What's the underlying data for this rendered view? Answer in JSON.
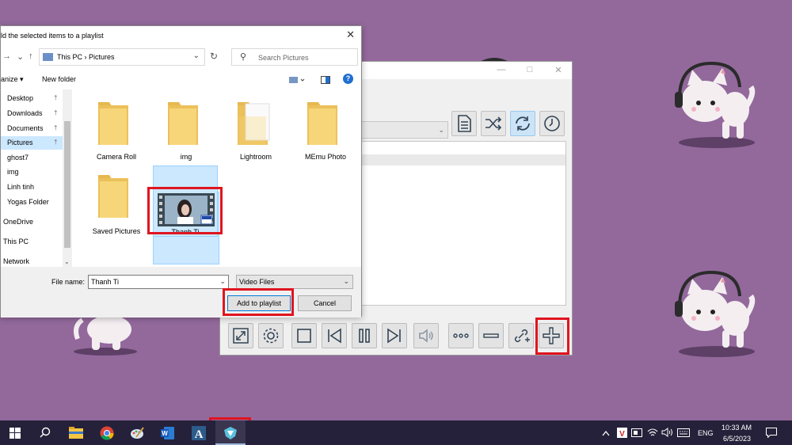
{
  "dialog": {
    "title": "ld the selected items to a playlist",
    "address": {
      "crumbs": "This PC  ›  Pictures"
    },
    "search_placeholder": "Search Pictures",
    "toolbar": {
      "organize": "anize ▾",
      "new_folder": "New folder"
    },
    "nav_items": [
      {
        "label": "Desktop",
        "pinned": true
      },
      {
        "label": "Downloads",
        "pinned": true
      },
      {
        "label": "Documents",
        "pinned": true
      },
      {
        "label": "Pictures",
        "pinned": true,
        "selected": true
      },
      {
        "label": "ghost7"
      },
      {
        "label": "img"
      },
      {
        "label": "Linh tinh"
      },
      {
        "label": "Yogas Folder"
      },
      {
        "label": "OneDrive"
      },
      {
        "label": "This PC"
      },
      {
        "label": "Network"
      }
    ],
    "files": [
      {
        "name": "Camera Roll",
        "type": "folder"
      },
      {
        "name": "img",
        "type": "folder"
      },
      {
        "name": "Lightroom",
        "type": "folder"
      },
      {
        "name": "MEmu Photo",
        "type": "folder"
      },
      {
        "name": "Saved Pictures",
        "type": "folder"
      },
      {
        "name": "Thanh Ti",
        "type": "video",
        "selected": true
      }
    ],
    "file_name_label": "File name:",
    "file_name_value": "Thanh Ti",
    "file_type_value": "Video Files",
    "add_button": "Add to playlist",
    "cancel_button": "Cancel",
    "pin_glyph": "†"
  },
  "player": {
    "top_buttons": [
      "playlist-doc",
      "shuffle",
      "repeat",
      "timer"
    ],
    "bottom_buttons": [
      "fullscreen",
      "settings",
      "stop",
      "previous",
      "pause",
      "next",
      "volume",
      "more",
      "remove",
      "add-url",
      "add"
    ]
  },
  "taskbar": {
    "lang": "ENG",
    "time": "10:33 AM",
    "date": "6/5/2023",
    "apps": [
      "start",
      "search",
      "file-explorer",
      "chrome",
      "paint",
      "word",
      "typora",
      "media-player"
    ]
  },
  "colors": {
    "desktop": "#93699c",
    "highlight": "#e0141f",
    "taskbar": "#26213a"
  }
}
